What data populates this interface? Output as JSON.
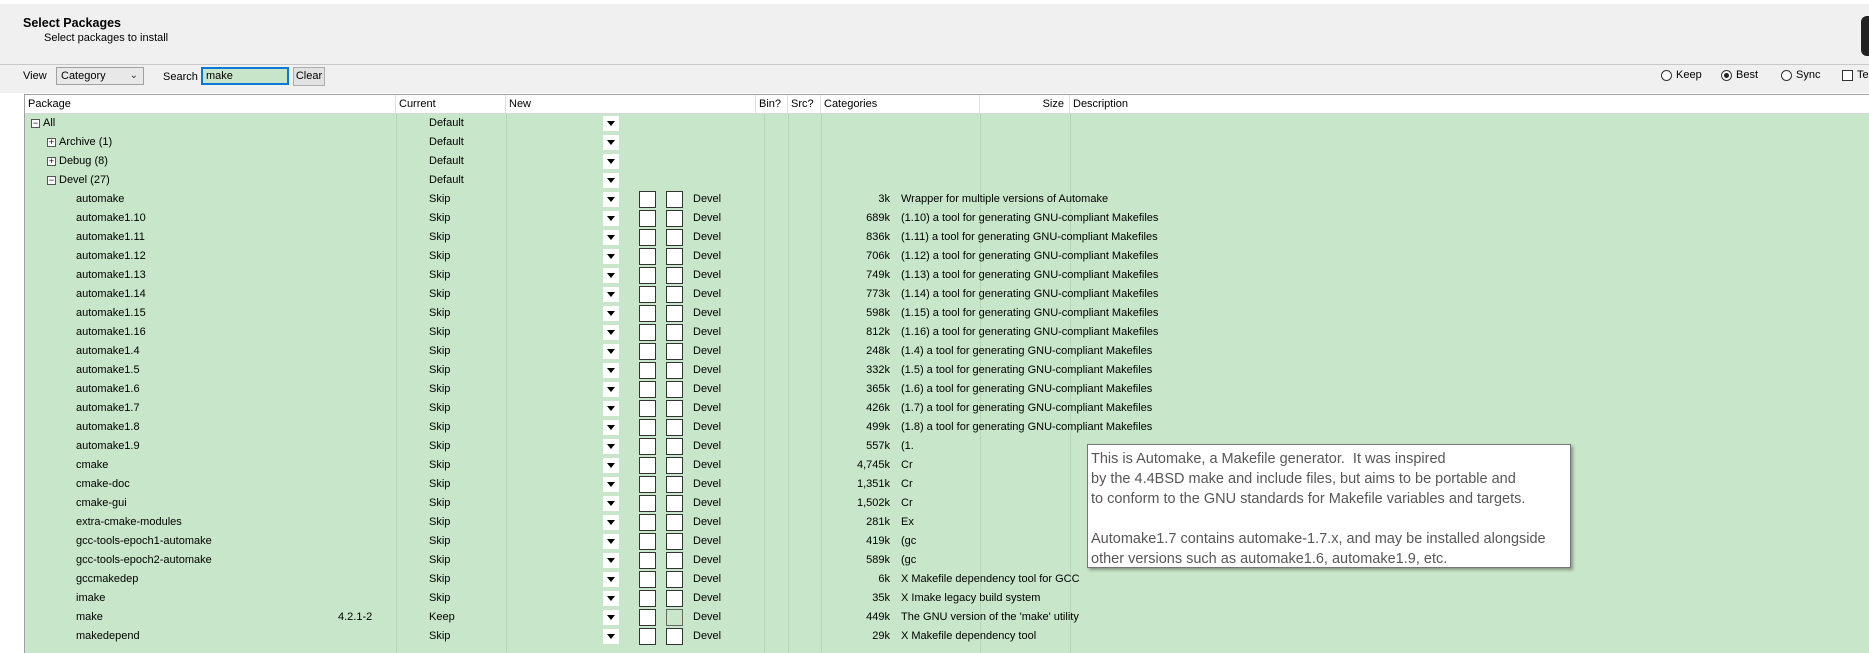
{
  "header": {
    "title": "Select Packages",
    "subtitle": "Select packages to install"
  },
  "toolbar": {
    "view_label": "View",
    "view_value": "Category",
    "search_label": "Search",
    "search_value": "make",
    "clear_label": "Clear",
    "modes": [
      {
        "label": "Keep",
        "selected": false
      },
      {
        "label": "Best",
        "selected": true
      },
      {
        "label": "Sync",
        "selected": false
      }
    ],
    "extra_checkbox_label": "Te"
  },
  "columns": {
    "package": "Package",
    "current": "Current",
    "new": "New",
    "bin": "Bin?",
    "src": "Src?",
    "categories": "Categories",
    "size": "Size",
    "description": "Description"
  },
  "rows": [
    {
      "level": 0,
      "expander": "minus",
      "package": "All",
      "current": "",
      "new": "Default",
      "bin": null,
      "src": null,
      "category": "",
      "size": "",
      "description": ""
    },
    {
      "level": 1,
      "expander": "plus",
      "package": "Archive (1)",
      "current": "",
      "new": "Default",
      "bin": null,
      "src": null,
      "category": "",
      "size": "",
      "description": ""
    },
    {
      "level": 1,
      "expander": "plus",
      "package": "Debug (8)",
      "current": "",
      "new": "Default",
      "bin": null,
      "src": null,
      "category": "",
      "size": "",
      "description": ""
    },
    {
      "level": 1,
      "expander": "minus",
      "package": "Devel (27)",
      "current": "",
      "new": "Default",
      "bin": null,
      "src": null,
      "category": "",
      "size": "",
      "description": ""
    },
    {
      "level": 2,
      "package": "automake",
      "current": "",
      "new": "Skip",
      "bin": false,
      "src": false,
      "category": "Devel",
      "size": "3k",
      "description": "Wrapper for multiple versions of Automake"
    },
    {
      "level": 2,
      "package": "automake1.10",
      "current": "",
      "new": "Skip",
      "bin": false,
      "src": false,
      "category": "Devel",
      "size": "689k",
      "description": "(1.10) a tool for generating GNU-compliant Makefiles"
    },
    {
      "level": 2,
      "package": "automake1.11",
      "current": "",
      "new": "Skip",
      "bin": false,
      "src": false,
      "category": "Devel",
      "size": "836k",
      "description": "(1.11) a tool for generating GNU-compliant Makefiles"
    },
    {
      "level": 2,
      "package": "automake1.12",
      "current": "",
      "new": "Skip",
      "bin": false,
      "src": false,
      "category": "Devel",
      "size": "706k",
      "description": "(1.12) a tool for generating GNU-compliant Makefiles"
    },
    {
      "level": 2,
      "package": "automake1.13",
      "current": "",
      "new": "Skip",
      "bin": false,
      "src": false,
      "category": "Devel",
      "size": "749k",
      "description": "(1.13) a tool for generating GNU-compliant Makefiles"
    },
    {
      "level": 2,
      "package": "automake1.14",
      "current": "",
      "new": "Skip",
      "bin": false,
      "src": false,
      "category": "Devel",
      "size": "773k",
      "description": "(1.14) a tool for generating GNU-compliant Makefiles"
    },
    {
      "level": 2,
      "package": "automake1.15",
      "current": "",
      "new": "Skip",
      "bin": false,
      "src": false,
      "category": "Devel",
      "size": "598k",
      "description": "(1.15) a tool for generating GNU-compliant Makefiles"
    },
    {
      "level": 2,
      "package": "automake1.16",
      "current": "",
      "new": "Skip",
      "bin": false,
      "src": false,
      "category": "Devel",
      "size": "812k",
      "description": "(1.16) a tool for generating GNU-compliant Makefiles"
    },
    {
      "level": 2,
      "package": "automake1.4",
      "current": "",
      "new": "Skip",
      "bin": false,
      "src": false,
      "category": "Devel",
      "size": "248k",
      "description": "(1.4) a tool for generating GNU-compliant Makefiles"
    },
    {
      "level": 2,
      "package": "automake1.5",
      "current": "",
      "new": "Skip",
      "bin": false,
      "src": false,
      "category": "Devel",
      "size": "332k",
      "description": "(1.5) a tool for generating GNU-compliant Makefiles"
    },
    {
      "level": 2,
      "package": "automake1.6",
      "current": "",
      "new": "Skip",
      "bin": false,
      "src": false,
      "category": "Devel",
      "size": "365k",
      "description": "(1.6) a tool for generating GNU-compliant Makefiles"
    },
    {
      "level": 2,
      "package": "automake1.7",
      "current": "",
      "new": "Skip",
      "bin": false,
      "src": false,
      "category": "Devel",
      "size": "426k",
      "description": "(1.7) a tool for generating GNU-compliant Makefiles"
    },
    {
      "level": 2,
      "package": "automake1.8",
      "current": "",
      "new": "Skip",
      "bin": false,
      "src": false,
      "category": "Devel",
      "size": "499k",
      "description": "(1.8) a tool for generating GNU-compliant Makefiles"
    },
    {
      "level": 2,
      "package": "automake1.9",
      "current": "",
      "new": "Skip",
      "bin": false,
      "src": false,
      "category": "Devel",
      "size": "557k",
      "description": "(1."
    },
    {
      "level": 2,
      "package": "cmake",
      "current": "",
      "new": "Skip",
      "bin": false,
      "src": false,
      "category": "Devel",
      "size": "4,745k",
      "description": "Cr"
    },
    {
      "level": 2,
      "package": "cmake-doc",
      "current": "",
      "new": "Skip",
      "bin": false,
      "src": false,
      "category": "Devel",
      "size": "1,351k",
      "description": "Cr"
    },
    {
      "level": 2,
      "package": "cmake-gui",
      "current": "",
      "new": "Skip",
      "bin": false,
      "src": false,
      "category": "Devel",
      "size": "1,502k",
      "description": "Cr"
    },
    {
      "level": 2,
      "package": "extra-cmake-modules",
      "current": "",
      "new": "Skip",
      "bin": false,
      "src": false,
      "category": "Devel",
      "size": "281k",
      "description": "Ex"
    },
    {
      "level": 2,
      "package": "gcc-tools-epoch1-automake",
      "current": "",
      "new": "Skip",
      "bin": false,
      "src": false,
      "category": "Devel",
      "size": "419k",
      "description": "(gc"
    },
    {
      "level": 2,
      "package": "gcc-tools-epoch2-automake",
      "current": "",
      "new": "Skip",
      "bin": false,
      "src": false,
      "category": "Devel",
      "size": "589k",
      "description": "(gc"
    },
    {
      "level": 2,
      "package": "gccmakedep",
      "current": "",
      "new": "Skip",
      "bin": false,
      "src": false,
      "category": "Devel",
      "size": "6k",
      "description": "X Makefile dependency tool for GCC"
    },
    {
      "level": 2,
      "package": "imake",
      "current": "",
      "new": "Skip",
      "bin": false,
      "src": false,
      "category": "Devel",
      "size": "35k",
      "description": "X Imake legacy build system"
    },
    {
      "level": 2,
      "package": "make",
      "current": "4.2.1-2",
      "new": "Keep",
      "bin": false,
      "src": "dim",
      "category": "Devel",
      "size": "449k",
      "description": "The GNU version of the 'make' utility"
    },
    {
      "level": 2,
      "package": "makedepend",
      "current": "",
      "new": "Skip",
      "bin": false,
      "src": false,
      "category": "Devel",
      "size": "29k",
      "description": "X Makefile dependency tool"
    }
  ],
  "tooltip": {
    "lines": [
      "This is Automake, a Makefile generator.  It was inspired",
      "by the 4.4BSD make and include files, but aims to be portable and",
      "to conform to the GNU standards for Makefile variables and targets.",
      "",
      "Automake1.7 contains automake-1.7.x, and may be installed alongside",
      "other versions such as automake1.6, automake1.9, etc."
    ]
  }
}
